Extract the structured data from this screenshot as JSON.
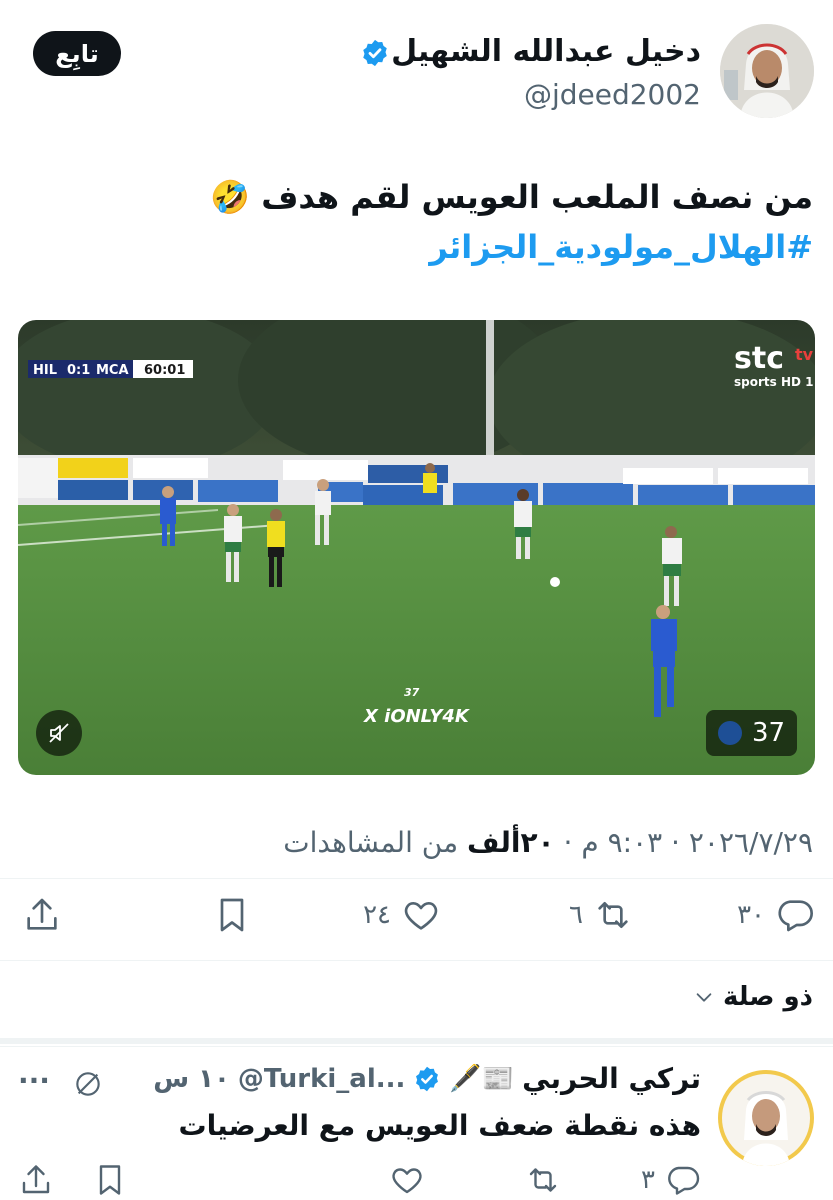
{
  "tweet": {
    "author_name": "دخيل عبدالله الشهيل",
    "author_handle": "@jdeed2002",
    "follow_label": "تابِع",
    "text_line1": "من نصف الملعب العويس لقم هدف",
    "text_emoji": "🤣",
    "hashtag": "#الهلال_مولودية_الجزائر",
    "video": {
      "score_home": "HIL",
      "score": "0:1",
      "score_away": "MCA",
      "clock": "60:01",
      "channel_main": "stc",
      "channel_sub": "sports HD 1",
      "channel_tv": "tv",
      "watermark_number": "37",
      "watermark_text": "X iONLY4K",
      "views_badge": "37"
    },
    "meta_date": "٢٠٢٦/٧/٢٩",
    "meta_time": "٩:٠٣ م",
    "meta_views_count": "٢٠ألف",
    "meta_views_label": "من المشاهدات",
    "actions": {
      "replies": "٣٠",
      "retweets": "٦",
      "likes": "٢٤"
    }
  },
  "relevant_label": "ذو صلة",
  "reply": {
    "author_name": "تركي الحربي",
    "name_emojis": "📰🖋️",
    "author_handle": "@Turki_al...",
    "time": "١٠ س",
    "text": "هذه نقطة ضعف العويس مع العرضيات",
    "more_label": "···",
    "replies": "٣"
  },
  "colors": {
    "accent": "#1d9bf0",
    "text": "#0f1419",
    "secondary": "#536471",
    "pitch": "#4f8a3a"
  }
}
